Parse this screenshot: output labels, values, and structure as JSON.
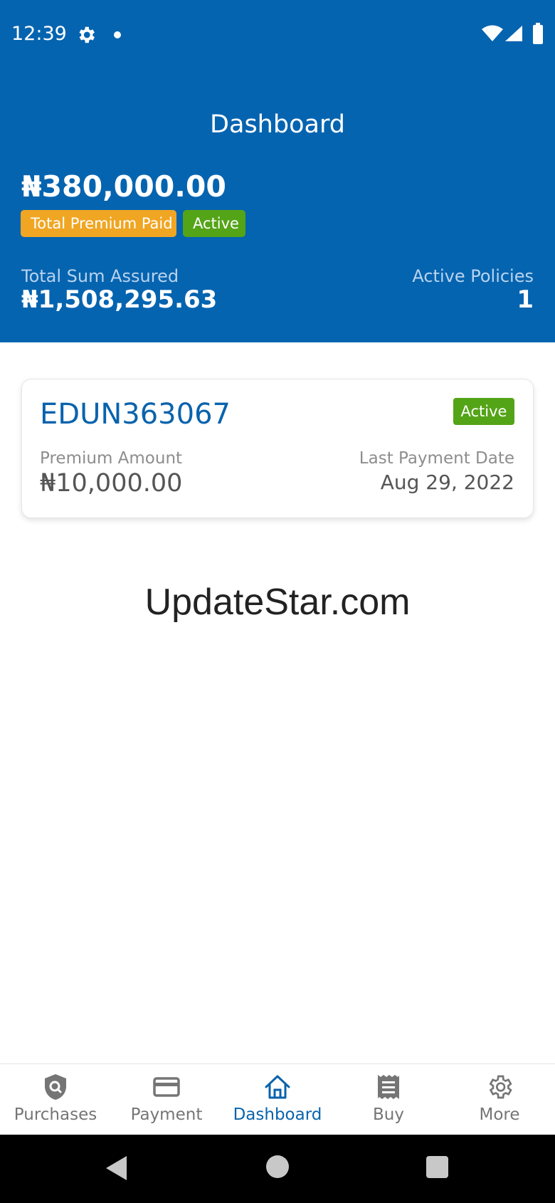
{
  "status_bar": {
    "time": "12:39",
    "icons": [
      "gear-icon",
      "notification-dot-icon",
      "wifi-icon",
      "signal-icon",
      "battery-icon"
    ]
  },
  "header": {
    "title": "Dashboard",
    "total_premium": "₦380,000.00",
    "premium_badge": "Total Premium Paid",
    "status_badge": "Active",
    "sum_assured_label": "Total Sum Assured",
    "sum_assured_value": "₦1,508,295.63",
    "active_policies_label": "Active Policies",
    "active_policies_value": "1"
  },
  "policy_card": {
    "policy_number": "EDUN363067",
    "status": "Active",
    "premium_label": "Premium Amount",
    "premium_value": "₦10,000.00",
    "last_payment_label": "Last Payment Date",
    "last_payment_value": "Aug 29, 2022"
  },
  "watermark": "UpdateStar.com",
  "bottom_nav": {
    "items": [
      {
        "label": "Purchases",
        "icon": "shield-search-icon"
      },
      {
        "label": "Payment",
        "icon": "credit-card-icon"
      },
      {
        "label": "Dashboard",
        "icon": "home-icon",
        "active": true
      },
      {
        "label": "Buy",
        "icon": "receipt-icon"
      },
      {
        "label": "More",
        "icon": "gear-icon"
      }
    ]
  },
  "colors": {
    "primary": "#0564b0",
    "accent_orange": "#f0a623",
    "active_green": "#54a417"
  }
}
